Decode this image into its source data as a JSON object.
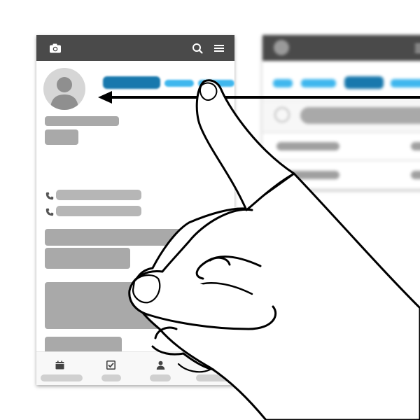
{
  "gesture": {
    "type": "swipe",
    "direction": "left",
    "icons": {
      "hand": "hand-icon",
      "arrow": "swipe-arrow-icon"
    }
  },
  "colors": {
    "toolbar": "#4a4a4a",
    "tab_active": "#1878ad",
    "tab_inactive": "#3fb7ee",
    "placeholder": "#a9a9a9"
  },
  "toolbar": {
    "icons": [
      "camera-icon",
      "search-icon",
      "menu-icon"
    ]
  },
  "contact": {
    "icons": [
      "avatar-icon",
      "phone-icon",
      "phone-icon"
    ]
  },
  "bottom_nav": {
    "icons": [
      "calendar-icon",
      "checkbox-icon",
      "person-icon"
    ]
  }
}
